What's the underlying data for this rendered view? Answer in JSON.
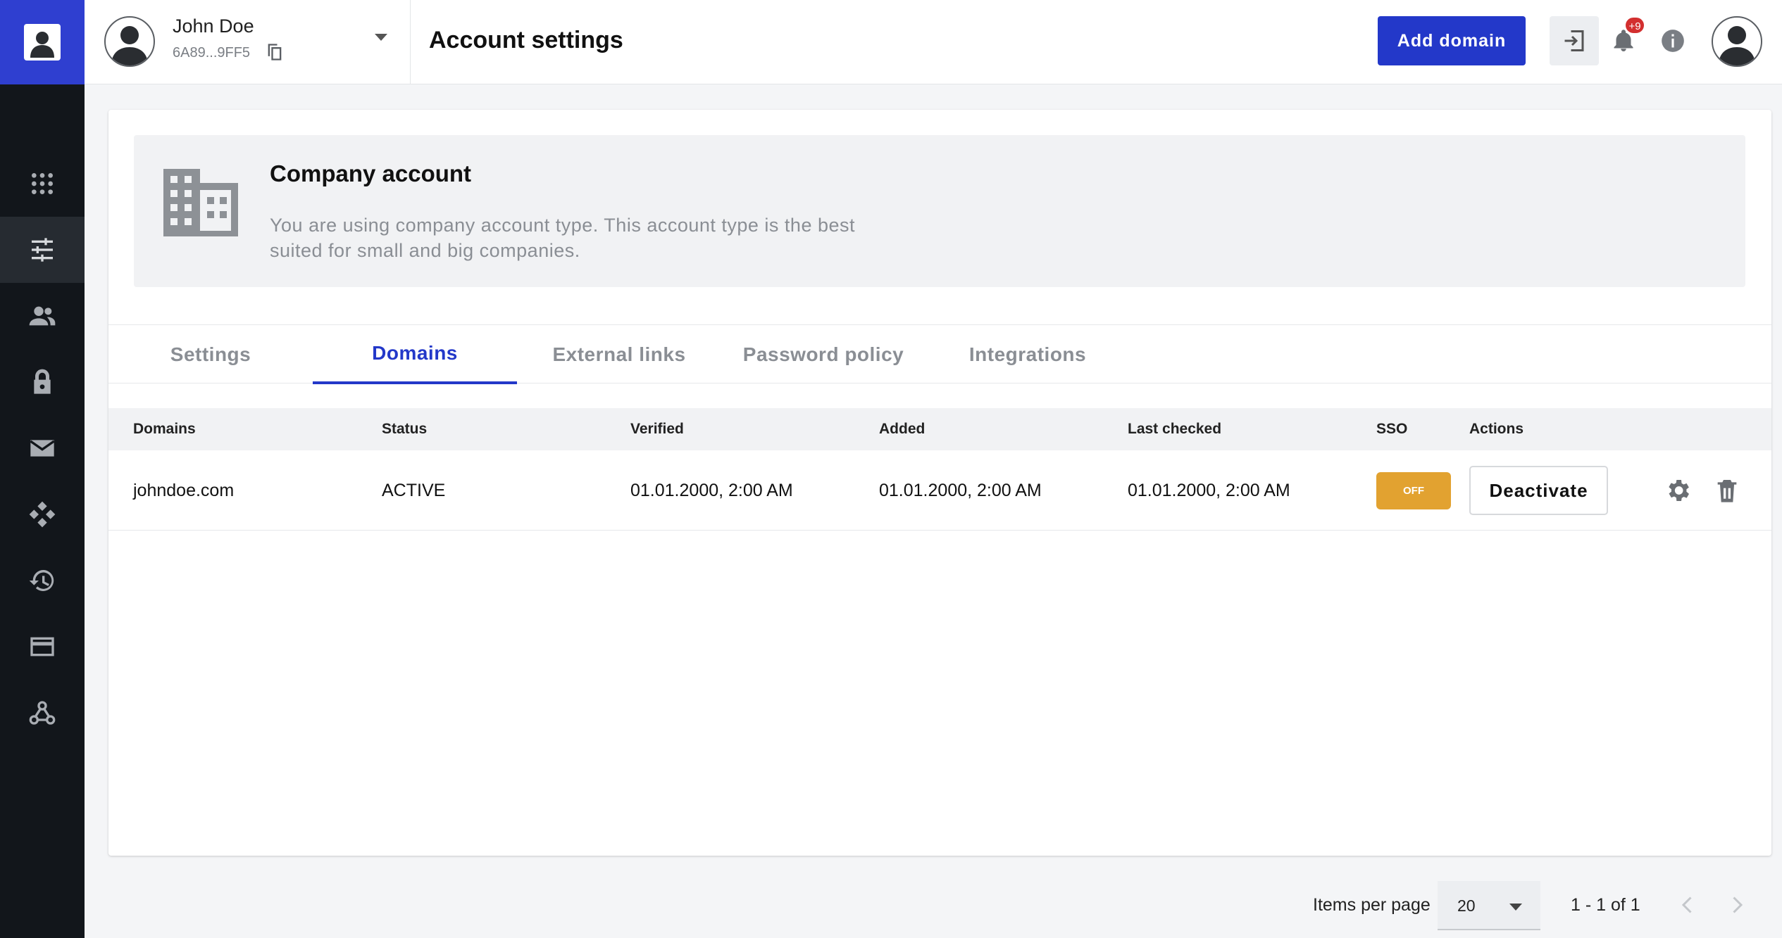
{
  "user": {
    "name": "John Doe",
    "id": "6A89...9FF5"
  },
  "header": {
    "title": "Account settings",
    "add_domain_label": "Add domain",
    "notifications_badge": "+9"
  },
  "company": {
    "title": "Company account",
    "description": "You are using company account type. This account type is the best suited for small and big companies."
  },
  "sidebar": {
    "items": [
      {
        "name": "apps",
        "icon": "apps-grid-icon",
        "active": false
      },
      {
        "name": "settings",
        "icon": "sliders-icon",
        "active": true
      },
      {
        "name": "users",
        "icon": "users-icon",
        "active": false
      },
      {
        "name": "security",
        "icon": "lock-icon",
        "active": false
      },
      {
        "name": "mail",
        "icon": "mail-icon",
        "active": false
      },
      {
        "name": "integrations",
        "icon": "diamond-nodes-icon",
        "active": false
      },
      {
        "name": "history",
        "icon": "history-icon",
        "active": false
      },
      {
        "name": "billing",
        "icon": "credit-card-icon",
        "active": false
      },
      {
        "name": "webhooks",
        "icon": "webhook-icon",
        "active": false
      }
    ]
  },
  "tabs": [
    "Settings",
    "Domains",
    "External links",
    "Password policy",
    "Integrations"
  ],
  "active_tab": "Domains",
  "table": {
    "headers": [
      "Domains",
      "Status",
      "Verified",
      "Added",
      "Last checked",
      "SSO",
      "Actions"
    ],
    "rows": [
      {
        "domain": "johndoe.com",
        "status": "ACTIVE",
        "verified": "01.01.2000, 2:00 AM",
        "added": "01.01.2000, 2:00 AM",
        "last_checked": "01.01.2000, 2:00 AM",
        "sso": "OFF",
        "action_label": "Deactivate"
      }
    ]
  },
  "pagination": {
    "label": "Items per page",
    "per_page": "20",
    "range": "1 - 1 of 1"
  },
  "colors": {
    "primary": "#2338c9",
    "sidebar": "#12161b",
    "sso_off": "#e2a230",
    "badge": "#d32f2f"
  }
}
